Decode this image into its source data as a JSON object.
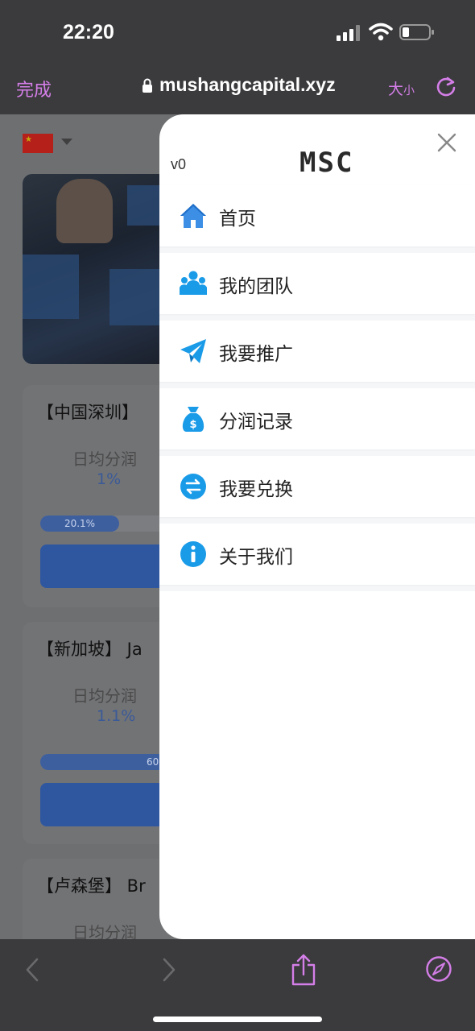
{
  "status_bar": {
    "time": "22:20"
  },
  "browser": {
    "done_label": "完成",
    "url": "mushangcapital.xyz",
    "size_label_big": "大",
    "size_label_small": "小"
  },
  "background_page": {
    "cards": [
      {
        "title": "【中国深圳】",
        "label": "日均分润",
        "value": "1%",
        "progress_label": "20.1%",
        "progress": 0.201
      },
      {
        "title": "【新加坡】 Ja",
        "label": "日均分润",
        "value": "1.1%",
        "progress_label": "60",
        "progress": 0.6
      },
      {
        "title": "【卢森堡】 Br",
        "label": "日均分润",
        "value": ""
      }
    ]
  },
  "drawer": {
    "version": "v0",
    "logo": "MSC",
    "menu": [
      {
        "label": "首页",
        "icon": "home-icon"
      },
      {
        "label": "我的团队",
        "icon": "team-icon"
      },
      {
        "label": "我要推广",
        "icon": "paper-plane-icon"
      },
      {
        "label": "分润记录",
        "icon": "money-bag-icon"
      },
      {
        "label": "我要兑换",
        "icon": "exchange-icon"
      },
      {
        "label": "关于我们",
        "icon": "info-icon"
      }
    ]
  },
  "colors": {
    "accent": "#d47ee8",
    "menu_icon_blue": "#1a9be8",
    "progress_blue": "#3e5f9e"
  }
}
